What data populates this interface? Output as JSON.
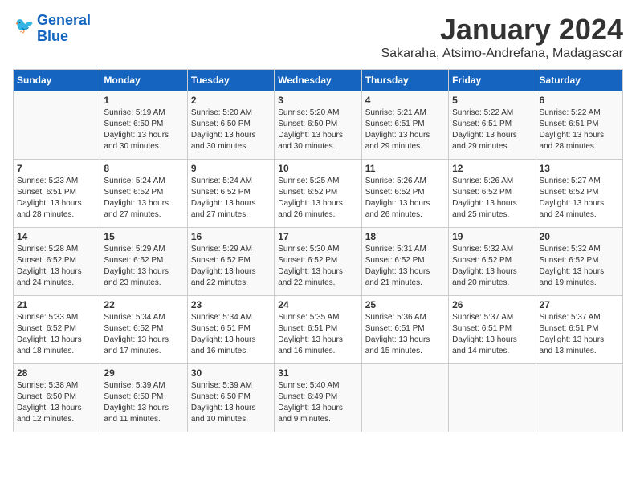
{
  "header": {
    "logo_line1": "General",
    "logo_line2": "Blue",
    "month": "January 2024",
    "location": "Sakaraha, Atsimo-Andrefana, Madagascar"
  },
  "days_of_week": [
    "Sunday",
    "Monday",
    "Tuesday",
    "Wednesday",
    "Thursday",
    "Friday",
    "Saturday"
  ],
  "weeks": [
    [
      {
        "day": "",
        "info": ""
      },
      {
        "day": "1",
        "info": "Sunrise: 5:19 AM\nSunset: 6:50 PM\nDaylight: 13 hours\nand 30 minutes."
      },
      {
        "day": "2",
        "info": "Sunrise: 5:20 AM\nSunset: 6:50 PM\nDaylight: 13 hours\nand 30 minutes."
      },
      {
        "day": "3",
        "info": "Sunrise: 5:20 AM\nSunset: 6:50 PM\nDaylight: 13 hours\nand 30 minutes."
      },
      {
        "day": "4",
        "info": "Sunrise: 5:21 AM\nSunset: 6:51 PM\nDaylight: 13 hours\nand 29 minutes."
      },
      {
        "day": "5",
        "info": "Sunrise: 5:22 AM\nSunset: 6:51 PM\nDaylight: 13 hours\nand 29 minutes."
      },
      {
        "day": "6",
        "info": "Sunrise: 5:22 AM\nSunset: 6:51 PM\nDaylight: 13 hours\nand 28 minutes."
      }
    ],
    [
      {
        "day": "7",
        "info": "Sunrise: 5:23 AM\nSunset: 6:51 PM\nDaylight: 13 hours\nand 28 minutes."
      },
      {
        "day": "8",
        "info": "Sunrise: 5:24 AM\nSunset: 6:52 PM\nDaylight: 13 hours\nand 27 minutes."
      },
      {
        "day": "9",
        "info": "Sunrise: 5:24 AM\nSunset: 6:52 PM\nDaylight: 13 hours\nand 27 minutes."
      },
      {
        "day": "10",
        "info": "Sunrise: 5:25 AM\nSunset: 6:52 PM\nDaylight: 13 hours\nand 26 minutes."
      },
      {
        "day": "11",
        "info": "Sunrise: 5:26 AM\nSunset: 6:52 PM\nDaylight: 13 hours\nand 26 minutes."
      },
      {
        "day": "12",
        "info": "Sunrise: 5:26 AM\nSunset: 6:52 PM\nDaylight: 13 hours\nand 25 minutes."
      },
      {
        "day": "13",
        "info": "Sunrise: 5:27 AM\nSunset: 6:52 PM\nDaylight: 13 hours\nand 24 minutes."
      }
    ],
    [
      {
        "day": "14",
        "info": "Sunrise: 5:28 AM\nSunset: 6:52 PM\nDaylight: 13 hours\nand 24 minutes."
      },
      {
        "day": "15",
        "info": "Sunrise: 5:29 AM\nSunset: 6:52 PM\nDaylight: 13 hours\nand 23 minutes."
      },
      {
        "day": "16",
        "info": "Sunrise: 5:29 AM\nSunset: 6:52 PM\nDaylight: 13 hours\nand 22 minutes."
      },
      {
        "day": "17",
        "info": "Sunrise: 5:30 AM\nSunset: 6:52 PM\nDaylight: 13 hours\nand 22 minutes."
      },
      {
        "day": "18",
        "info": "Sunrise: 5:31 AM\nSunset: 6:52 PM\nDaylight: 13 hours\nand 21 minutes."
      },
      {
        "day": "19",
        "info": "Sunrise: 5:32 AM\nSunset: 6:52 PM\nDaylight: 13 hours\nand 20 minutes."
      },
      {
        "day": "20",
        "info": "Sunrise: 5:32 AM\nSunset: 6:52 PM\nDaylight: 13 hours\nand 19 minutes."
      }
    ],
    [
      {
        "day": "21",
        "info": "Sunrise: 5:33 AM\nSunset: 6:52 PM\nDaylight: 13 hours\nand 18 minutes."
      },
      {
        "day": "22",
        "info": "Sunrise: 5:34 AM\nSunset: 6:52 PM\nDaylight: 13 hours\nand 17 minutes."
      },
      {
        "day": "23",
        "info": "Sunrise: 5:34 AM\nSunset: 6:51 PM\nDaylight: 13 hours\nand 16 minutes."
      },
      {
        "day": "24",
        "info": "Sunrise: 5:35 AM\nSunset: 6:51 PM\nDaylight: 13 hours\nand 16 minutes."
      },
      {
        "day": "25",
        "info": "Sunrise: 5:36 AM\nSunset: 6:51 PM\nDaylight: 13 hours\nand 15 minutes."
      },
      {
        "day": "26",
        "info": "Sunrise: 5:37 AM\nSunset: 6:51 PM\nDaylight: 13 hours\nand 14 minutes."
      },
      {
        "day": "27",
        "info": "Sunrise: 5:37 AM\nSunset: 6:51 PM\nDaylight: 13 hours\nand 13 minutes."
      }
    ],
    [
      {
        "day": "28",
        "info": "Sunrise: 5:38 AM\nSunset: 6:50 PM\nDaylight: 13 hours\nand 12 minutes."
      },
      {
        "day": "29",
        "info": "Sunrise: 5:39 AM\nSunset: 6:50 PM\nDaylight: 13 hours\nand 11 minutes."
      },
      {
        "day": "30",
        "info": "Sunrise: 5:39 AM\nSunset: 6:50 PM\nDaylight: 13 hours\nand 10 minutes."
      },
      {
        "day": "31",
        "info": "Sunrise: 5:40 AM\nSunset: 6:49 PM\nDaylight: 13 hours\nand 9 minutes."
      },
      {
        "day": "",
        "info": ""
      },
      {
        "day": "",
        "info": ""
      },
      {
        "day": "",
        "info": ""
      }
    ]
  ]
}
